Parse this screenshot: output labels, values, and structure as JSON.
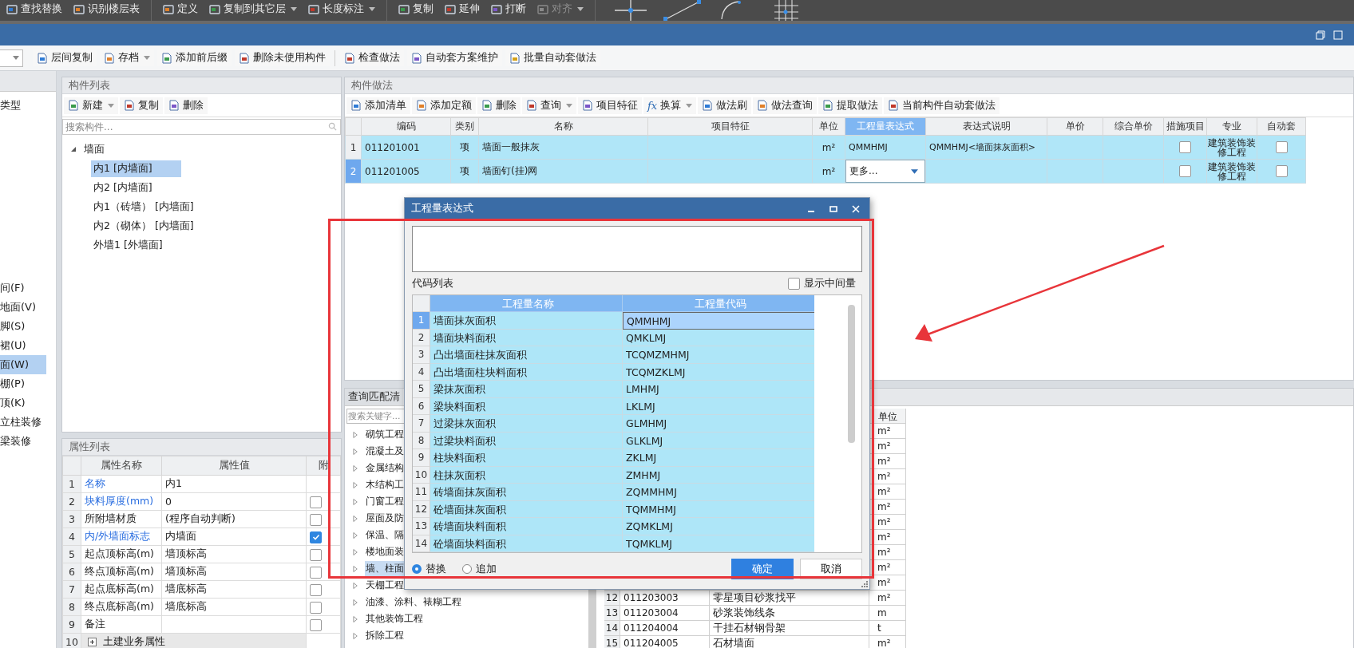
{
  "ribbon": {
    "groups": [
      [
        {
          "label": "查找替换",
          "dropdown": false,
          "disabled": false
        },
        {
          "label": "识别楼层表",
          "dropdown": false,
          "disabled": false
        }
      ],
      [
        {
          "label": "定义",
          "dropdown": false,
          "disabled": false
        },
        {
          "label": "复制到其它层",
          "dropdown": true,
          "disabled": false
        },
        {
          "label": "长度标注",
          "dropdown": true,
          "disabled": false
        }
      ],
      [
        {
          "label": "复制",
          "dropdown": false,
          "disabled": false
        },
        {
          "label": "延伸",
          "dropdown": false,
          "disabled": false
        },
        {
          "label": "打断",
          "dropdown": false,
          "disabled": false
        },
        {
          "label": "对齐",
          "dropdown": true,
          "disabled": true
        }
      ]
    ]
  },
  "toolbar": {
    "groups": [
      [
        {
          "label": "层间复制",
          "dropdown": false
        },
        {
          "label": "存档",
          "dropdown": true
        },
        {
          "label": "添加前后缀",
          "dropdown": false
        },
        {
          "label": "删除未使用构件",
          "dropdown": false
        }
      ],
      [
        {
          "label": "检查做法",
          "dropdown": false
        },
        {
          "label": "自动套方案维护",
          "dropdown": false
        },
        {
          "label": "批量自动套做法",
          "dropdown": false
        }
      ]
    ]
  },
  "sidebar": {
    "title": "类型",
    "items": [
      {
        "label": "间(F)",
        "selected": false
      },
      {
        "label": "地面(V)",
        "selected": false
      },
      {
        "label": "脚(S)",
        "selected": false
      },
      {
        "label": "裙(U)",
        "selected": false
      },
      {
        "label": "面(W)",
        "selected": true
      },
      {
        "label": "棚(P)",
        "selected": false
      },
      {
        "label": "顶(K)",
        "selected": false
      },
      {
        "label": "立柱装修",
        "selected": false
      },
      {
        "label": "梁装修",
        "selected": false
      }
    ]
  },
  "component_list": {
    "title": "构件列表",
    "toolbar": [
      {
        "label": "新建",
        "dropdown": true
      },
      {
        "label": "复制",
        "dropdown": false
      },
      {
        "label": "删除",
        "dropdown": false
      }
    ],
    "search": {
      "placeholder": "搜索构件..."
    },
    "tree": [
      {
        "label": "墙面",
        "expanded": true,
        "selected": false,
        "children": [
          {
            "label": "内1 [内墙面]",
            "selected": true
          },
          {
            "label": "内2 [内墙面]",
            "selected": false
          },
          {
            "label": "内1（砖墙） [内墙面]",
            "selected": false
          },
          {
            "label": "内2（砌体） [内墙面]",
            "selected": false
          },
          {
            "label": "外墙1 [外墙面]",
            "selected": false
          }
        ]
      }
    ]
  },
  "properties": {
    "title": "属性列表",
    "columns": [
      "属性名称",
      "属性值",
      "附"
    ],
    "rows": [
      {
        "index": "1",
        "kind": "property",
        "name": "名称",
        "linked": true,
        "value": "内1"
      },
      {
        "index": "2",
        "kind": "property",
        "name": "块料厚度(mm)",
        "linked": true,
        "value": "0",
        "checked": false
      },
      {
        "index": "3",
        "kind": "property",
        "name": "所附墙材质",
        "linked": false,
        "value": "(程序自动判断)",
        "checked": false
      },
      {
        "index": "4",
        "kind": "property",
        "name": "内/外墙面标志",
        "linked": true,
        "value": "内墙面",
        "checked": true
      },
      {
        "index": "5",
        "kind": "property",
        "name": "起点顶标高(m)",
        "linked": false,
        "value": "墙顶标高",
        "checked": false
      },
      {
        "index": "6",
        "kind": "property",
        "name": "终点顶标高(m)",
        "linked": false,
        "value": "墙顶标高",
        "checked": false
      },
      {
        "index": "7",
        "kind": "property",
        "name": "起点底标高(m)",
        "linked": false,
        "value": "墙底标高",
        "checked": false
      },
      {
        "index": "8",
        "kind": "property",
        "name": "终点底标高(m)",
        "linked": false,
        "value": "墙底标高",
        "checked": false
      },
      {
        "index": "9",
        "kind": "property",
        "name": "备注",
        "linked": false,
        "checked": false
      },
      {
        "index": "10",
        "kind": "group",
        "name": "土建业务属性",
        "expanded": false
      }
    ]
  },
  "methods": {
    "title": "构件做法",
    "toolbar": [
      {
        "label": "添加清单",
        "dropdown": false
      },
      {
        "label": "添加定额",
        "dropdown": false
      },
      {
        "label": "删除",
        "dropdown": false
      },
      {
        "label": "查询",
        "dropdown": true
      },
      {
        "label": "项目特征",
        "dropdown": false
      },
      {
        "label": "换算",
        "dropdown": true,
        "glyph": "fx"
      },
      {
        "label": "做法刷",
        "dropdown": false
      },
      {
        "label": "做法查询",
        "dropdown": false
      },
      {
        "label": "提取做法",
        "dropdown": false
      },
      {
        "label": "当前构件自动套做法",
        "dropdown": false
      }
    ],
    "columns": [
      {
        "label": "编码",
        "selected": false
      },
      {
        "label": "类别",
        "selected": false
      },
      {
        "label": "名称",
        "selected": false
      },
      {
        "label": "项目特征",
        "selected": false
      },
      {
        "label": "单位",
        "selected": false
      },
      {
        "label": "工程量表达式",
        "selected": true
      },
      {
        "label": "表达式说明",
        "selected": false
      },
      {
        "label": "单价",
        "selected": false
      },
      {
        "label": "综合单价",
        "selected": false
      },
      {
        "label": "措施项目",
        "selected": false
      },
      {
        "label": "专业",
        "selected": false
      },
      {
        "label": "自动套",
        "selected": false
      }
    ],
    "rows": [
      {
        "index": "1",
        "selected": false,
        "code": "011201001",
        "category": "项",
        "name": "墙面一般抹灰",
        "unit": "m²",
        "expression": {
          "kind": "text",
          "text": "QMMHMJ"
        },
        "description": "QMMHMJ<墙面抹灰面积>",
        "measure_checked": false,
        "specialty": "建筑装饰装修工程",
        "auto_checked": false
      },
      {
        "index": "2",
        "selected": true,
        "code": "011201005",
        "category": "项",
        "name": "墙面钉(挂)网",
        "unit": "m²",
        "expression": {
          "kind": "dropdown",
          "text": "更多..."
        },
        "measure_checked": false,
        "specialty": "建筑装饰装修工程",
        "auto_checked": false
      }
    ]
  },
  "query": {
    "title": "查询匹配清",
    "search": {
      "placeholder": "搜索关键字..."
    },
    "tree": [
      {
        "label": "砌筑工程",
        "selected": false
      },
      {
        "label": "混凝土及",
        "selected": false
      },
      {
        "label": "金属结构",
        "selected": false
      },
      {
        "label": "木结构工",
        "selected": false
      },
      {
        "label": "门窗工程",
        "selected": false
      },
      {
        "label": "屋面及防",
        "selected": false
      },
      {
        "label": "保温、隔",
        "selected": false
      },
      {
        "label": "楼地面装",
        "selected": false
      },
      {
        "label": "墙、柱面",
        "selected": true
      },
      {
        "label": "天棚工程",
        "selected": false
      },
      {
        "label": "油漆、涂料、裱糊工程",
        "selected": false
      },
      {
        "label": "其他装饰工程",
        "selected": false
      },
      {
        "label": "拆除工程",
        "selected": false
      }
    ],
    "table": {
      "unit_column": "单位",
      "rows": [
        {
          "unit": "m²"
        },
        {
          "unit": "m²"
        },
        {
          "unit": "m²"
        },
        {
          "unit": "m²"
        },
        {
          "unit": "m²"
        },
        {
          "unit": "m²"
        },
        {
          "unit": "m²"
        },
        {
          "unit": "m²"
        },
        {
          "unit": "m²"
        },
        {
          "unit": "m²"
        },
        {
          "unit": "m²"
        },
        {
          "index": "12",
          "code": "011203003",
          "name": "零星项目砂浆找平",
          "unit": "m²"
        },
        {
          "index": "13",
          "code": "011203004",
          "name": "砂浆装饰线条",
          "unit": "m"
        },
        {
          "index": "14",
          "code": "011204004",
          "name": "干挂石材钢骨架",
          "unit": "t"
        },
        {
          "index": "15",
          "code": "011204005",
          "name": "石材墙面",
          "unit": "m²"
        }
      ]
    }
  },
  "dialog": {
    "title": "工程量表达式",
    "list_label": "代码列表",
    "show_intermediate": {
      "label": "显示中间量",
      "checked": false
    },
    "columns": [
      "工程量名称",
      "工程量代码"
    ],
    "rows": [
      {
        "index": "1",
        "name": "墙面抹灰面积",
        "code": "QMMHMJ",
        "selected": true
      },
      {
        "index": "2",
        "name": "墙面块料面积",
        "code": "QMKLMJ",
        "selected": false
      },
      {
        "index": "3",
        "name": "凸出墙面柱抹灰面积",
        "code": "TCQMZMHMJ",
        "selected": false
      },
      {
        "index": "4",
        "name": "凸出墙面柱块料面积",
        "code": "TCQMZKLMJ",
        "selected": false
      },
      {
        "index": "5",
        "name": "梁抹灰面积",
        "code": "LMHMJ",
        "selected": false
      },
      {
        "index": "6",
        "name": "梁块料面积",
        "code": "LKLMJ",
        "selected": false
      },
      {
        "index": "7",
        "name": "过梁抹灰面积",
        "code": "GLMHMJ",
        "selected": false
      },
      {
        "index": "8",
        "name": "过梁块料面积",
        "code": "GLKLMJ",
        "selected": false
      },
      {
        "index": "9",
        "name": "柱块料面积",
        "code": "ZKLMJ",
        "selected": false
      },
      {
        "index": "10",
        "name": "柱抹灰面积",
        "code": "ZMHMJ",
        "selected": false
      },
      {
        "index": "11",
        "name": "砖墙面抹灰面积",
        "code": "ZQMMHMJ",
        "selected": false
      },
      {
        "index": "12",
        "name": "砼墙面抹灰面积",
        "code": "TQMMHMJ",
        "selected": false
      },
      {
        "index": "13",
        "name": "砖墙面块料面积",
        "code": "ZQMKLMJ",
        "selected": false
      },
      {
        "index": "14",
        "name": "砼墙面块料面积",
        "code": "TQMKLMJ",
        "selected": false
      }
    ],
    "options": [
      {
        "label": "替换",
        "selected": true
      },
      {
        "label": "追加",
        "selected": false
      }
    ],
    "buttons": [
      {
        "label": "确定",
        "primary": true
      },
      {
        "label": "取消",
        "primary": false
      }
    ]
  }
}
